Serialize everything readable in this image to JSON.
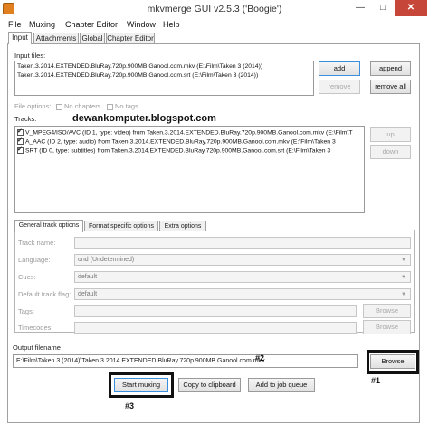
{
  "window": {
    "title": "mkvmerge GUI v2.5.3 ('Boogie')",
    "min_glyph": "—",
    "max_glyph": "□",
    "close_glyph": "✕"
  },
  "menu": [
    "File",
    "Muxing",
    "Chapter Editor",
    "Window",
    "Help"
  ],
  "tabs": [
    "Input",
    "Attachments",
    "Global",
    "Chapter Editor"
  ],
  "input_files": {
    "label": "Input files:",
    "files": [
      "Taken.3.2014.EXTENDED.BluRay.720p.900MB.Ganool.com.mkv (E:\\Film\\Taken 3 (2014))",
      "Taken.3.2014.EXTENDED.BluRay.720p.900MB.Ganool.com.srt (E:\\Film\\Taken 3 (2014))"
    ],
    "buttons": {
      "add": "add",
      "append": "append",
      "remove": "remove",
      "remove_all": "remove all"
    }
  },
  "file_options": {
    "label": "File options:",
    "no_chapters": "No chapters",
    "no_tags": "No tags"
  },
  "tracks": {
    "label": "Tracks:",
    "watermark": "dewankomputer.blogspot.com",
    "items": [
      "V_MPEG4/ISO/AVC (ID 1, type: video) from Taken.3.2014.EXTENDED.BluRay.720p.900MB.Ganool.com.mkv (E:\\Film\\T",
      "A_AAC (ID 2, type: audio) from Taken.3.2014.EXTENDED.BluRay.720p.900MB.Ganool.com.mkv (E:\\Film\\Taken 3",
      "SRT (ID 0, type: subtitles) from Taken.3.2014.EXTENDED.BluRay.720p.900MB.Ganool.com.srt (E:\\Film\\Taken 3"
    ],
    "up": "up",
    "down": "down"
  },
  "track_options_tabs": [
    "General track options",
    "Format specific options",
    "Extra options"
  ],
  "track_fields": {
    "track_name": "Track name:",
    "language": "Language:",
    "language_value": "und (Undetermined)",
    "cues": "Cues:",
    "cues_value": "default",
    "default_flag": "Default track flag:",
    "default_flag_value": "default",
    "tags": "Tags:",
    "timecodes": "Timecodes:",
    "browse": "Browse"
  },
  "output": {
    "label": "Output filename",
    "value": "E:\\Film\\Taken 3 (2014)\\Taken.3.2014.EXTENDED.BluRay.720p.900MB.Ganool.com.mkv",
    "browse": "Browse"
  },
  "bottom_buttons": {
    "start": "Start muxing",
    "clipboard": "Copy to clipboard",
    "job_queue": "Add to job queue"
  },
  "annotations": {
    "a1": "#1",
    "a2": "#2",
    "a3": "#3"
  }
}
